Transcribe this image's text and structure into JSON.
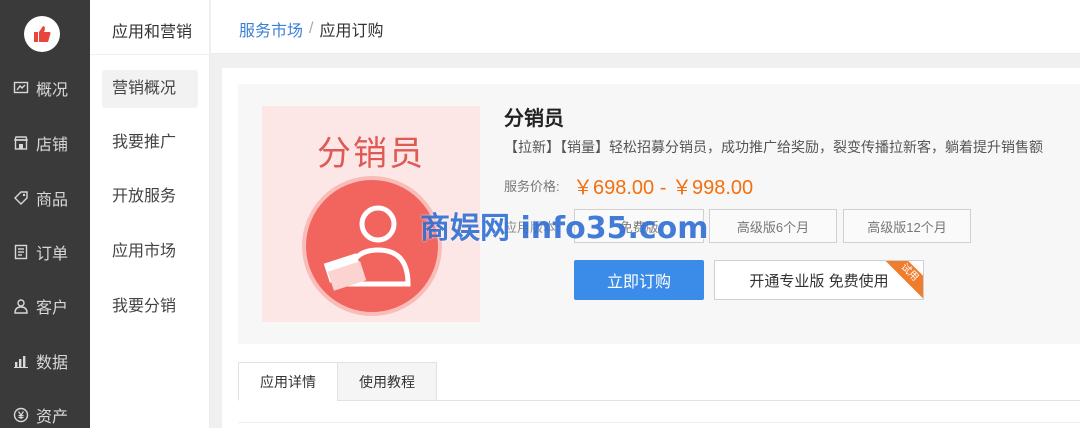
{
  "nav": {
    "items": [
      {
        "label": "概况",
        "icon": "overview-icon"
      },
      {
        "label": "店铺",
        "icon": "store-icon"
      },
      {
        "label": "商品",
        "icon": "tag-icon"
      },
      {
        "label": "订单",
        "icon": "order-icon"
      },
      {
        "label": "客户",
        "icon": "customer-icon"
      },
      {
        "label": "数据",
        "icon": "chart-icon"
      },
      {
        "label": "资产",
        "icon": "yen-icon"
      }
    ]
  },
  "subnav": {
    "title": "应用和营销",
    "items": [
      "营销概况",
      "我要推广",
      "开放服务",
      "应用市场",
      "我要分销"
    ]
  },
  "breadcrumb": {
    "parent": "服务市场",
    "separator": "/",
    "current": "应用订购"
  },
  "product": {
    "thumb_title": "分销员",
    "name": "分销员",
    "description": "【拉新】【销量】轻松招募分销员，成功推广给奖励，裂变传播拉新客，躺着提升销售额",
    "price_label": "服务价格:",
    "price": "￥698.00 - ￥998.00",
    "version_label": "应用版本:",
    "versions": [
      "免费版",
      "高级版6个月",
      "高级版12个月"
    ],
    "buy_label": "立即订购",
    "trial_label": "开通专业版 免费使用",
    "trial_badge": "试用"
  },
  "watermark": "商娱网 info35.com",
  "tabs": [
    "应用详情",
    "使用教程"
  ],
  "colors": {
    "nav_bg": "#3a3a3a",
    "accent": "#3b8be8",
    "price": "#f2700f",
    "brand_red": "#e8453c"
  }
}
